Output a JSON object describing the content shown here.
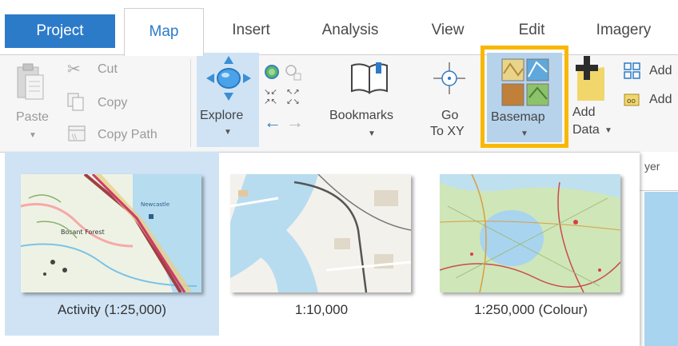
{
  "tabs": [
    {
      "label": "Project"
    },
    {
      "label": "Map"
    },
    {
      "label": "Insert"
    },
    {
      "label": "Analysis"
    },
    {
      "label": "View"
    },
    {
      "label": "Edit"
    },
    {
      "label": "Imagery"
    }
  ],
  "clipboard": {
    "paste": "Paste",
    "cut": "Cut",
    "copy": "Copy",
    "copy_path": "Copy Path"
  },
  "navigate": {
    "explore": "Explore",
    "bookmarks": "Bookmarks",
    "go_to_xy_line1": "Go",
    "go_to_xy_line2": "To XY"
  },
  "layer": {
    "basemap": "Basemap",
    "add_data_line1": "Add",
    "add_data_line2": "Data",
    "add_partial_1": "Add",
    "add_partial_2": "Add",
    "group_partial": "yer"
  },
  "basemap_gallery": [
    {
      "label": "Activity (1:25,000)",
      "selected": true
    },
    {
      "label": "1:10,000",
      "selected": false
    },
    {
      "label": "1:250,000 (Colour)",
      "selected": false
    }
  ],
  "colors": {
    "project_tab": "#2c7bc9",
    "highlight": "#f8b800",
    "selected_tile": "#cfe3f5",
    "ribbon_bg": "#f6f6f6"
  }
}
